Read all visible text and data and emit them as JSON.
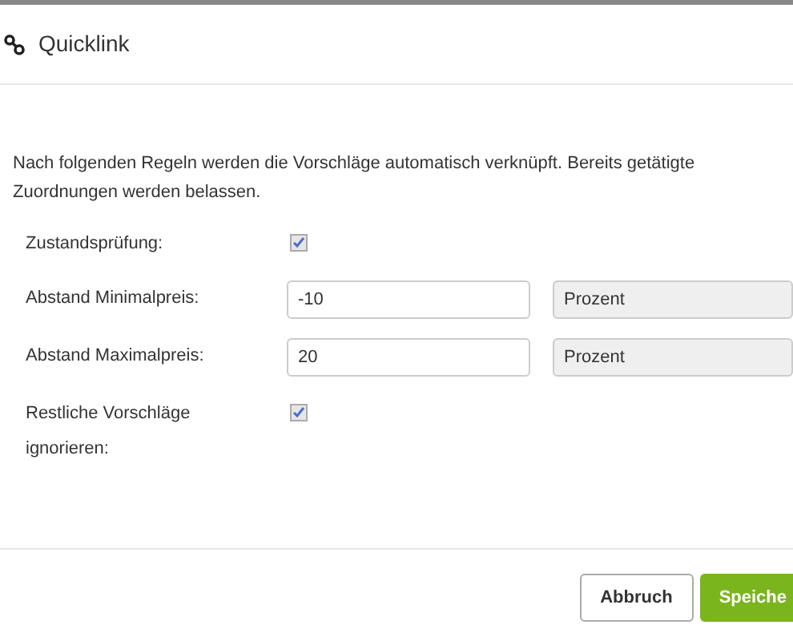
{
  "dialog": {
    "title": "Quicklink"
  },
  "description": "Nach folgenden Regeln werden die Vorschläge automatisch verknüpft. Bereits getätigte Zuordnungen werden belassen.",
  "fields": [
    {
      "kind": "checkbox",
      "label": "Zustandsprüfung:",
      "checked": true
    },
    {
      "kind": "number",
      "label": "Abstand Minimalpreis:",
      "value": "-10",
      "unit": "Prozent"
    },
    {
      "kind": "number",
      "label": "Abstand Maximalpreis:",
      "value": "20",
      "unit": "Prozent"
    },
    {
      "kind": "checkbox",
      "label": "Restliche Vorschläge ignorieren:",
      "checked": true
    }
  ],
  "buttons": [
    {
      "kind": "secondary",
      "label": "Abbruch"
    },
    {
      "kind": "primary",
      "label": "Speiche"
    }
  ]
}
